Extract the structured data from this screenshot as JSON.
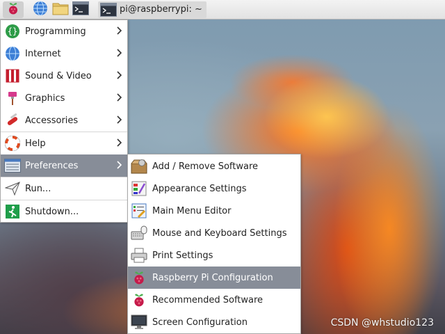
{
  "taskbar": {
    "launchers": [
      {
        "icon": "raspberry-menu-icon"
      },
      {
        "icon": "web-browser-globe-icon"
      },
      {
        "icon": "file-manager-folder-icon"
      },
      {
        "icon": "terminal-icon"
      }
    ],
    "task": {
      "icon": "terminal-icon",
      "label": "pi@raspberrypi: ~"
    }
  },
  "main_menu": {
    "items": [
      {
        "label": "Programming",
        "icon": "programming-icon",
        "has_submenu": true
      },
      {
        "label": "Internet",
        "icon": "internet-globe-icon",
        "has_submenu": true
      },
      {
        "label": "Sound & Video",
        "icon": "sound-video-icon",
        "has_submenu": true
      },
      {
        "label": "Graphics",
        "icon": "graphics-paintbrush-icon",
        "has_submenu": true
      },
      {
        "label": "Accessories",
        "icon": "accessories-knife-icon",
        "has_submenu": true
      },
      {
        "label": "Help",
        "icon": "help-lifebuoy-icon",
        "has_submenu": true
      },
      {
        "label": "Preferences",
        "icon": "preferences-icon",
        "has_submenu": true,
        "active": true
      },
      {
        "label": "Run...",
        "icon": "run-paper-plane-icon",
        "has_submenu": false
      },
      {
        "label": "Shutdown...",
        "icon": "shutdown-exit-icon",
        "has_submenu": false
      }
    ]
  },
  "preferences_menu": {
    "items": [
      {
        "label": "Add / Remove Software",
        "icon": "package-box-icon"
      },
      {
        "label": "Appearance Settings",
        "icon": "appearance-palette-icon"
      },
      {
        "label": "Main Menu Editor",
        "icon": "menu-editor-icon"
      },
      {
        "label": "Mouse and Keyboard Settings",
        "icon": "keyboard-mouse-icon"
      },
      {
        "label": "Print Settings",
        "icon": "printer-icon"
      },
      {
        "label": "Raspberry Pi Configuration",
        "icon": "raspberry-pi-icon",
        "active": true
      },
      {
        "label": "Recommended Software",
        "icon": "raspberry-pi-icon"
      },
      {
        "label": "Screen Configuration",
        "icon": "monitor-icon"
      }
    ]
  },
  "watermark": "CSDN @whstudio123",
  "colors": {
    "active_item_bg": "#878d98",
    "menu_bg": "#ffffff",
    "taskbar_bg": "#e8e8e8",
    "raspberry_red": "#c51a4a",
    "raspberry_green": "#4caf50"
  }
}
